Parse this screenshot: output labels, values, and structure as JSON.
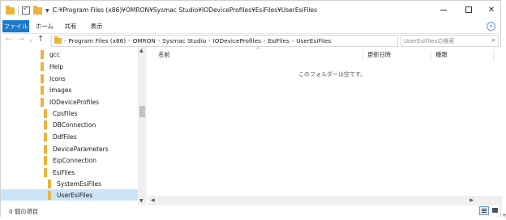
{
  "window": {
    "title": "C:¥Program Files (x86)¥OMRON¥Sysmac Studio¥IODeviceProfiles¥EsiFiles¥UserEsiFiles",
    "controls": {
      "minimize": "—",
      "maximize": "□",
      "close": "✕"
    }
  },
  "ribbon": {
    "tabs": [
      "ファイル",
      "ホーム",
      "共有",
      "表示"
    ],
    "expand_icon": "chevron-down-icon"
  },
  "nav": {
    "back": "←",
    "forward": "→",
    "recent": "∨",
    "up": "↑"
  },
  "address": {
    "breadcrumbs": [
      "Program Files (x86)",
      "OMRON",
      "Sysmac Studio",
      "IODeviceProfiles",
      "EsiFiles",
      "UserEsiFiles"
    ],
    "dropdown": "∨",
    "refresh": "↻"
  },
  "search": {
    "placeholder": "UserEsiFilesの検索",
    "icon": "⌕"
  },
  "tree": {
    "items": [
      {
        "label": "gcc",
        "selected": false
      },
      {
        "label": "Help",
        "selected": false
      },
      {
        "label": "Icons",
        "selected": false
      },
      {
        "label": "Images",
        "selected": false
      },
      {
        "label": "IODeviceProfiles",
        "selected": false
      },
      {
        "label": "CpsFiles",
        "selected": false
      },
      {
        "label": "DBConnection",
        "selected": false
      },
      {
        "label": "DdfFiles",
        "selected": false
      },
      {
        "label": "DeviceParameters",
        "selected": false
      },
      {
        "label": "EipConnection",
        "selected": false
      },
      {
        "label": "EsiFiles",
        "selected": false
      },
      {
        "label": "SystemEsiFiles",
        "selected": false
      },
      {
        "label": "UserEsiFiles",
        "selected": true
      }
    ]
  },
  "content": {
    "columns": [
      "名前",
      "更新日時",
      "種類"
    ],
    "sort_caret": "^",
    "empty_message": "このフォルダーは空です。"
  },
  "statusbar": {
    "item_count": "0 個の項目"
  },
  "colors": {
    "accent": "#1979ca",
    "folder": "#e9b43c",
    "selection": "#cce4f7"
  }
}
